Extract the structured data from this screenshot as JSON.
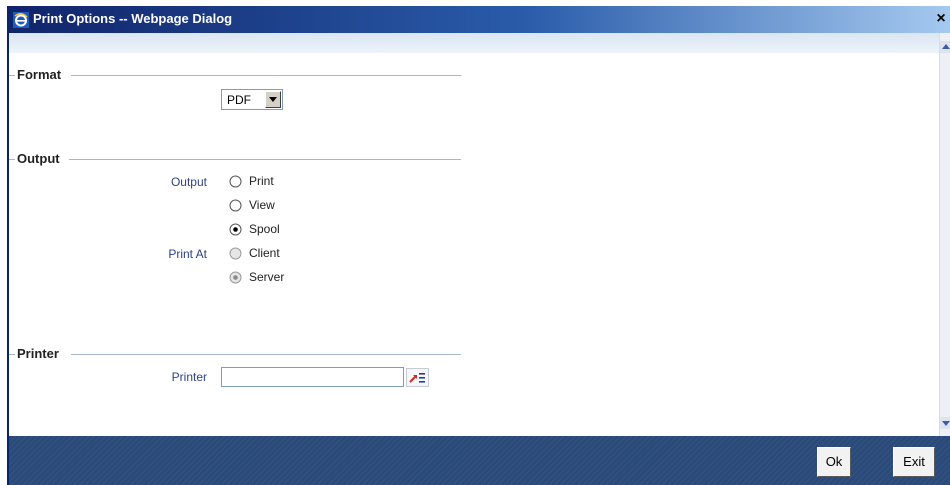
{
  "window": {
    "title": "Print Options -- Webpage Dialog",
    "close_glyph": "×",
    "icon": "ie-icon"
  },
  "sections": {
    "format": {
      "legend": "Format",
      "select_value": "PDF"
    },
    "output": {
      "legend": "Output",
      "output_label": "Output",
      "output_options": [
        {
          "label": "Print",
          "checked": false
        },
        {
          "label": "View",
          "checked": false
        },
        {
          "label": "Spool",
          "checked": true
        }
      ],
      "print_at_label": "Print At",
      "print_at_options": [
        {
          "label": "Client",
          "checked": false,
          "disabled": true
        },
        {
          "label": "Server",
          "checked": true,
          "disabled": true
        }
      ]
    },
    "printer": {
      "legend": "Printer",
      "field_label": "Printer",
      "value": "",
      "lov_icon": "list-of-values-icon"
    }
  },
  "footer": {
    "ok_label": "Ok",
    "exit_label": "Exit"
  },
  "colors": {
    "titlebar_start": "#10246a",
    "footer_bg": "#2a4a7a",
    "field_label": "#2b3f8c"
  }
}
